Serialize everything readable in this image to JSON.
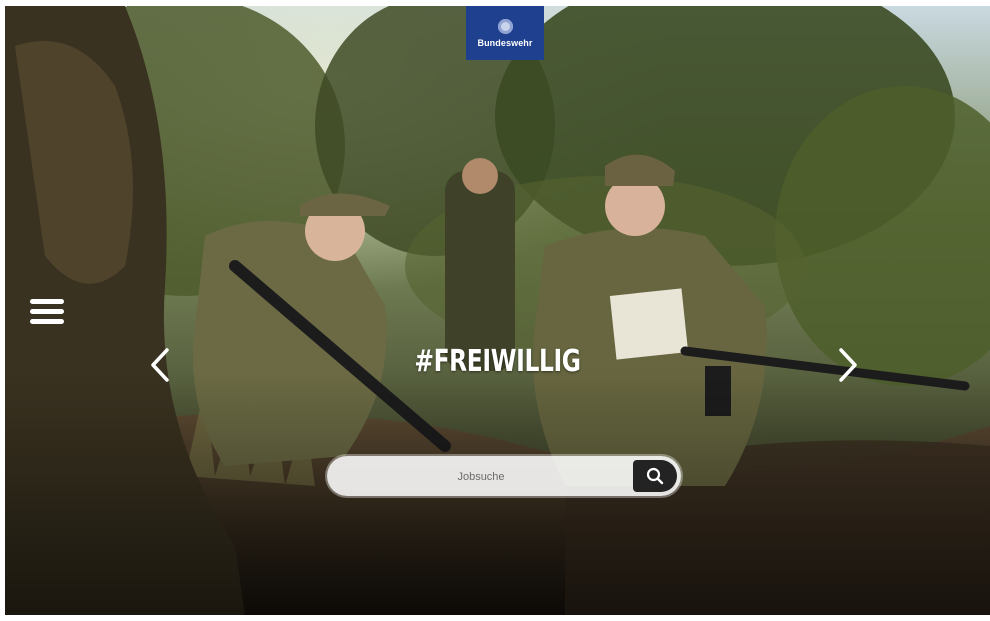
{
  "brand": {
    "logo_text": "Bundeswehr",
    "color": "#1f3f8f"
  },
  "hero": {
    "headline": "#FREIWILLIG"
  },
  "navigation": {
    "menu_icon": "hamburger-menu-icon",
    "prev_icon": "chevron-left-icon",
    "next_icon": "chevron-right-icon"
  },
  "search": {
    "placeholder": "Jobsuche",
    "button_icon": "search-icon"
  }
}
